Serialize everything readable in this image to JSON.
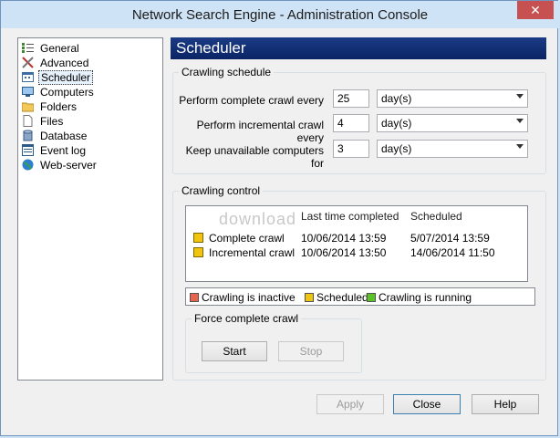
{
  "window": {
    "title": "Network Search Engine - Administration Console",
    "close_glyph": "✕"
  },
  "tree": {
    "items": [
      {
        "label": "General",
        "icon": "general-icon"
      },
      {
        "label": "Advanced",
        "icon": "advanced-icon"
      },
      {
        "label": "Scheduler",
        "icon": "scheduler-icon",
        "selected": true
      },
      {
        "label": "Computers",
        "icon": "computers-icon"
      },
      {
        "label": "Folders",
        "icon": "folder-icon"
      },
      {
        "label": "Files",
        "icon": "file-icon"
      },
      {
        "label": "Database",
        "icon": "database-icon"
      },
      {
        "label": "Event log",
        "icon": "event-log-icon"
      },
      {
        "label": "Web-server",
        "icon": "globe-icon"
      }
    ]
  },
  "panel": {
    "title": "Scheduler"
  },
  "crawling_schedule": {
    "label": "Crawling schedule",
    "rows": [
      {
        "label": "Perform complete crawl every",
        "value": "25",
        "unit": "day(s)"
      },
      {
        "label": "Perform incremental crawl every",
        "value": "4",
        "unit": "day(s)"
      },
      {
        "label": "Keep unavailable computers for",
        "value": "3",
        "unit": "day(s)"
      }
    ]
  },
  "crawling_control": {
    "label": "Crawling control",
    "columns": [
      "Last time completed",
      "Scheduled"
    ],
    "rows": [
      {
        "name": "Complete crawl",
        "last": "10/06/2014 13:59",
        "scheduled": "5/07/2014 13:59"
      },
      {
        "name": "Incremental crawl",
        "last": "10/06/2014 13:50",
        "scheduled": "14/06/2014 11:50"
      }
    ],
    "legend": [
      {
        "label": "Crawling is inactive",
        "color": "#e8644c"
      },
      {
        "label": "Scheduled",
        "color": "#f1c40f"
      },
      {
        "label": "Crawling is running",
        "color": "#58c322"
      }
    ],
    "watermark": "download"
  },
  "force_crawl": {
    "label": "Force complete crawl",
    "start": "Start",
    "stop": "Stop"
  },
  "footer": {
    "apply": "Apply",
    "close": "Close",
    "help": "Help"
  }
}
